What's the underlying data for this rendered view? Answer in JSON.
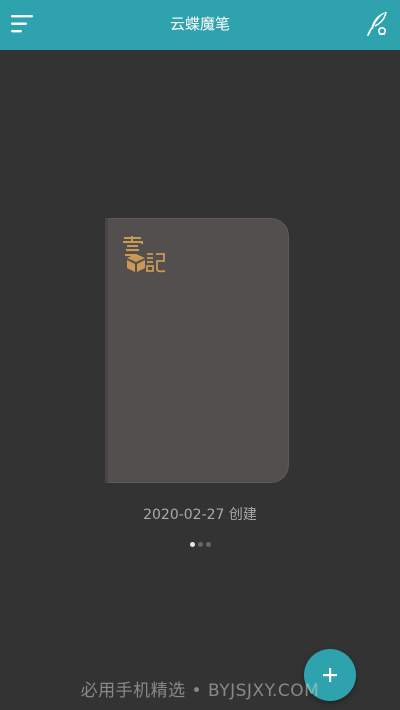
{
  "app": {
    "title": "云蝶魔笔",
    "header_color": "#2ea3ad",
    "background_color": "#333333"
  },
  "header": {
    "menu_icon": "menu-icon",
    "right_icon": "quill-icon"
  },
  "notebook": {
    "logo_text": "雲記",
    "cover_color": "#534f4e",
    "logo_color": "#c89a55",
    "caption": "2020-02-27 创建"
  },
  "pager": {
    "count": 3,
    "active_index": 0
  },
  "fab": {
    "icon": "plus-icon"
  },
  "watermark": {
    "text": "必用手机精选 • BYJSJXY.COM"
  }
}
